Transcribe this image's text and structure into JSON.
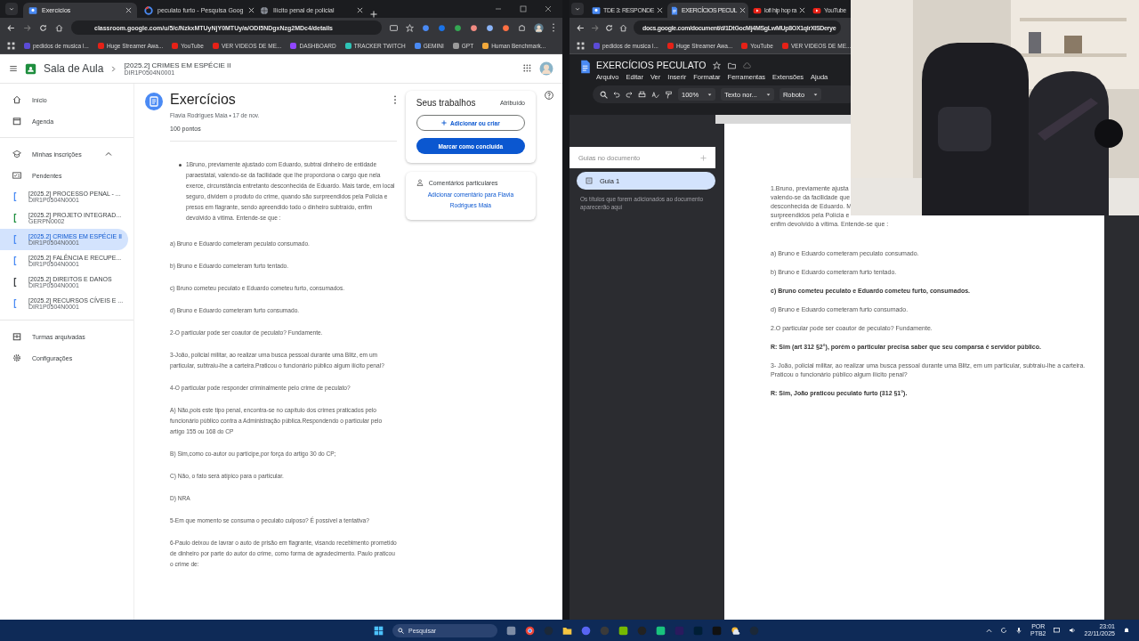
{
  "left_browser": {
    "tabs": [
      {
        "title": "Exercícios",
        "kind": "classroom",
        "selected": true
      },
      {
        "title": "peculato furto - Pesquisa Goog",
        "kind": "google",
        "selected": false
      },
      {
        "title": "Ilícito penal de policial",
        "kind": "globe",
        "selected": false
      }
    ],
    "url": "classroom.google.com/u/5/c/NzkxMTUyNjY0MTUy/a/ODI5NDgxNzg2MDc4/details",
    "bookmarks": [
      {
        "label": "pedidos de musica l...",
        "color": "#5b4bd6"
      },
      {
        "label": "Huge Streamer Awa...",
        "color": "#e62117"
      },
      {
        "label": "YouTube",
        "color": "#e62117"
      },
      {
        "label": "VER VIDEOS DE ME...",
        "color": "#e62117"
      },
      {
        "label": "DASHBOARD",
        "color": "#9146ff"
      },
      {
        "label": "TRACKER TWITCH",
        "color": "#2ec4b6"
      },
      {
        "label": "GEMINI",
        "color": "#4a8af4"
      },
      {
        "label": "GPT",
        "color": "#9a9a9a"
      },
      {
        "label": "Human Benchmark...",
        "color": "#f2a93b"
      }
    ]
  },
  "classroom": {
    "app_name": "Sala de Aula",
    "course_title": "[2025.2] CRIMES EM ESPÉCIE II",
    "course_code": "DIR1P0504N0001",
    "nav": [
      {
        "label": "Início",
        "kind": "home"
      },
      {
        "label": "Agenda",
        "kind": "calendar"
      }
    ],
    "enrollments": {
      "label": "Minhas inscrições",
      "expanded": true,
      "pending": "Pendentes",
      "classes": [
        {
          "name": "[2025.2] PROCESSO PENAL - ...",
          "code": "DIR1P0504N0001",
          "color": "#4a8af4",
          "selected": false
        },
        {
          "name": "[2025.2] PROJETO INTEGRAD...",
          "code": "GERPN0002",
          "color": "#1e8e3e",
          "selected": false
        },
        {
          "name": "[2025.2] CRIMES EM ESPÉCIE II",
          "code": "DIR1P0504N0001",
          "color": "#4a8af4",
          "selected": true
        },
        {
          "name": "[2025.2] FALÊNCIA E RECUPE...",
          "code": "DIR1P0504N0001",
          "color": "#4a8af4",
          "selected": false
        },
        {
          "name": "[2025.2] DIREITOS E DANOS",
          "code": "DIR1P0504N0001",
          "color": "#3c4043",
          "selected": false
        },
        {
          "name": "[2025.2] RECURSOS CÍVEIS E ...",
          "code": "DIR1P0504N0001",
          "color": "#4a8af4",
          "selected": false
        }
      ]
    },
    "nav_bottom": [
      {
        "label": "Turmas arquivadas",
        "kind": "archive"
      },
      {
        "label": "Configurações",
        "kind": "settings"
      }
    ],
    "assignment": {
      "title": "Exercícios",
      "meta": "Flavia Rodrigues Maia • 17 de nov.",
      "points": "100 pontos",
      "intro": "1Bruno, previamente ajustado com Eduardo, subtrai dinheiro de entidade paraestatal, valendo-se da facilidade que lhe proporciona o cargo que nela exerce, circunstância entretanto desconhecida de Eduardo. Mais tarde, em local seguro, dividem o produto do crime, quando são surpreendidos pela Polícia e presos em flagrante, sendo apreendido todo o dinheiro subtraído, enfim devolvido à vítima. Entende-se que :",
      "items": [
        "a) Bruno e Eduardo cometeram peculato consumado.",
        "b) Bruno e Eduardo cometeram furto tentado.",
        "c) Bruno cometeu peculato e Eduardo cometeu furto, consumados.",
        "d) Bruno e Eduardo cometeram furto consumado.",
        "2-O particular pode ser coautor de peculato? Fundamente.",
        "3-João, policial militar, ao realizar uma busca pessoal durante uma Blitz, em um particular, subtraiu-lhe a carteira.Praticou o funcionário público algum ilícito penal?",
        "4-O particular pode responder criminalmente pelo crime de peculato?",
        "A) Não,pois este tipo penal, encontra-se no capítulo dos crimes praticados pelo funcionário público contra a Administração pública.Respondendo o particular pelo artigo 155 ou 168 do CP",
        "B) Sim,como co-autor ou partícipe,por força do artigo 30 do CP;",
        "C) Não, o fato será atípico para o particular.",
        "D) NRA",
        "5-Em que momento se consuma o peculato culposo? É possível a tentativa?",
        "6-Paulo deixou de lavrar o auto de prisão em flagrante, visando recebimento prometido de dinheiro por parte do autor do crime, como forma de agradecimento. Paulo praticou o crime de:"
      ]
    },
    "your_work": {
      "title": "Seus trabalhos",
      "status": "Atribuído",
      "add_button": "Adicionar ou criar",
      "done_button": "Marcar como concluída"
    },
    "private_comments": {
      "title": "Comentários particulares",
      "link": "Adicionar comentário para Flavia Rodrigues Maia"
    }
  },
  "right_browser": {
    "tabs": [
      {
        "title": "TDE 3: RESPONDE",
        "kind": "classroom",
        "selected": false
      },
      {
        "title": "EXERCÍCIOS PECUL",
        "kind": "docs",
        "selected": true
      },
      {
        "title": "lofi hip hop ra",
        "kind": "youtube",
        "selected": false
      },
      {
        "title": "YouTube",
        "kind": "youtube",
        "selected": false
      }
    ],
    "url": "docs.google.com/document/d/1DtGocMj4MSgLwMUp8OX1qlrXISDerye",
    "bookmarks": [
      {
        "label": "pedidos de musica l...",
        "color": "#5b4bd6"
      },
      {
        "label": "Huge Streamer Awa...",
        "color": "#e62117"
      },
      {
        "label": "YouTube",
        "color": "#e62117"
      },
      {
        "label": "VER VIDEOS DE ME...",
        "color": "#e62117"
      }
    ]
  },
  "docs": {
    "title": "EXERCÍCIOS PECULATO",
    "menus": [
      "Arquivo",
      "Editar",
      "Ver",
      "Inserir",
      "Formatar",
      "Ferramentas",
      "Extensões",
      "Ajuda"
    ],
    "zoom": "100%",
    "style": "Texto nor...",
    "font": "Roboto",
    "outline": {
      "title": "Guias no documento",
      "tabs": [
        {
          "label": "Guia 1",
          "selected": true
        }
      ],
      "hint": "Os títulos que forem adicionados ao documento aparecerão aqui"
    },
    "lines": [
      "1.Bruno, previamente ajusta",
      "valendo-se da facilidade que",
      "desconhecida de Eduardo. M",
      "surpreendidos pela Polícia e",
      "enfim devolvido à vítima. Entende-se que :"
    ],
    "paragraphs": [
      {
        "text": "a) Bruno e Eduardo cometeram peculato consumado.",
        "bold": false
      },
      {
        "text": "b) Bruno e Eduardo cometeram furto tentado.",
        "bold": false
      },
      {
        "text": "c) Bruno cometeu peculato e Eduardo cometeu furto, consumados.",
        "bold": true
      },
      {
        "text": "d) Bruno e Eduardo cometeram furto consumado.",
        "bold": false
      },
      {
        "text": "2.O particular pode ser coautor de peculato? Fundamente.",
        "bold": false
      },
      {
        "text": "R: Sim (art 312 §2°), porém o particular precisa saber que seu comparsa é servidor público.",
        "bold": true
      },
      {
        "text": "3- João, policial militar, ao realizar uma busca pessoal durante uma Blitz, em um particular, subtraiu-lhe a carteira. Praticou o funcionário público algum ilícito penal?",
        "bold": false
      },
      {
        "text": "R: Sim, João praticou peculato furto (312 §1°).",
        "bold": true
      }
    ]
  },
  "taskbar": {
    "search": "Pesquisar",
    "language": "POR",
    "layout": "PTB2",
    "time": "23:01",
    "date": "22/11/2025"
  }
}
